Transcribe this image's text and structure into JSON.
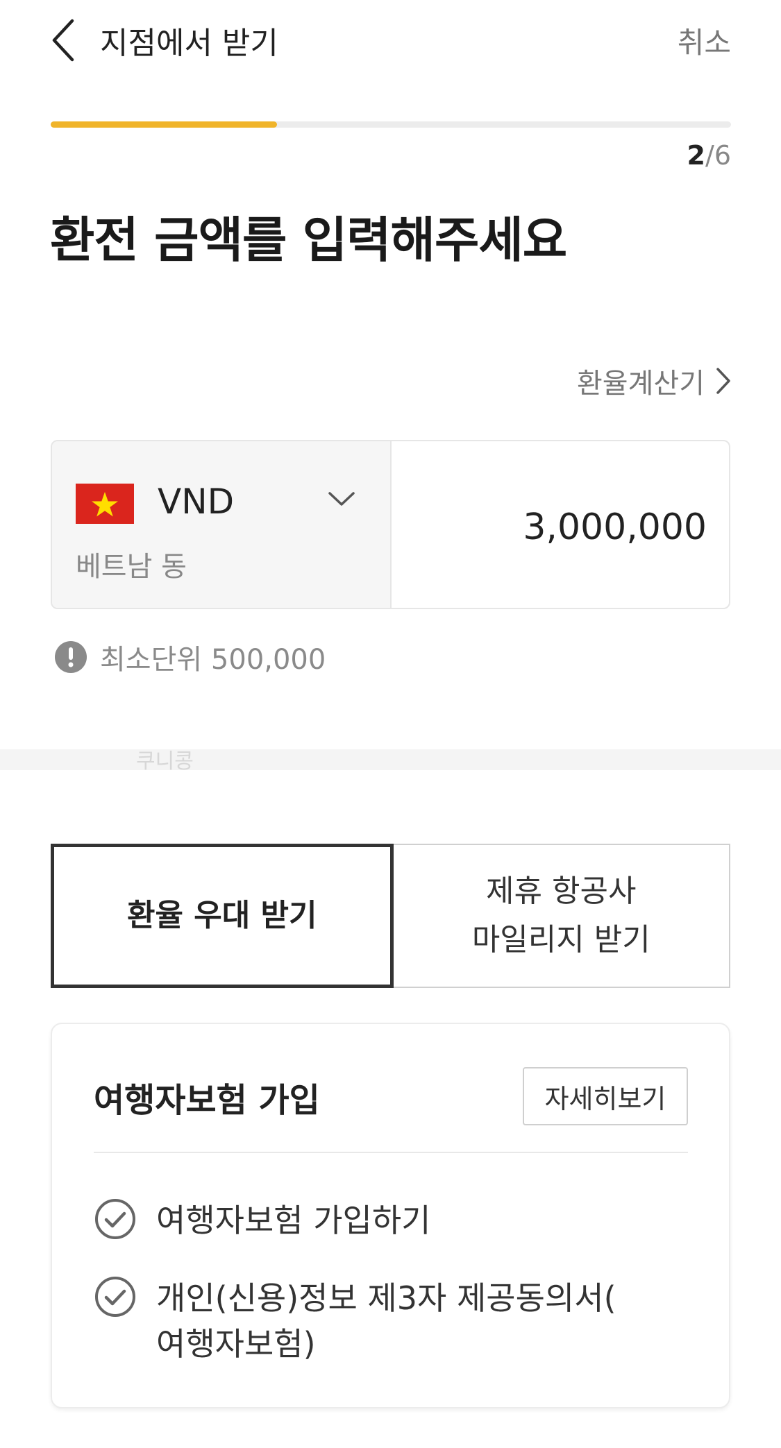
{
  "header": {
    "title": "지점에서 받기",
    "cancel_label": "취소"
  },
  "progress": {
    "current": "2",
    "separator": "/",
    "total": "6",
    "fraction": 0.333
  },
  "main": {
    "title": "환전 금액를 입력해주세요",
    "calc_link": "환율계산기"
  },
  "currency": {
    "code": "VND",
    "name": "베트남 동",
    "flag": "vietnam-flag",
    "amount": "3,000,000"
  },
  "min_unit": {
    "text": "최소단위 500,000"
  },
  "watermark": "쿠니콩",
  "benefits": {
    "selected_label": "환율 우대 받기",
    "other_label": "제휴 항공사\n마일리지 받기"
  },
  "insurance": {
    "title": "여행자보험 가입",
    "detail_button": "자세히보기",
    "items": [
      {
        "label": "여행자보험 가입하기"
      },
      {
        "label": "개인(신용)정보 제3자 제공동의서(\n여행자보험)"
      }
    ]
  },
  "colors": {
    "accent": "#f0b42a",
    "flag_red": "#da251d",
    "flag_star": "#ffde00"
  }
}
